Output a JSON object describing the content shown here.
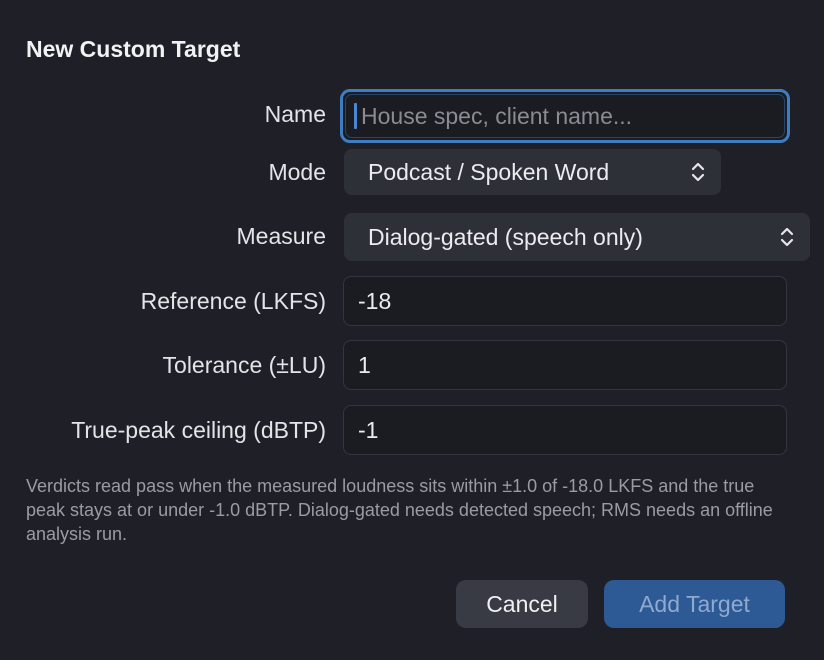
{
  "dialog": {
    "title": "New Custom Target",
    "name": {
      "label": "Name",
      "value": "",
      "placeholder": "House spec, client name..."
    },
    "mode": {
      "label": "Mode",
      "selected": "Podcast / Spoken Word"
    },
    "measure": {
      "label": "Measure",
      "selected": "Dialog-gated (speech only)"
    },
    "reference": {
      "label": "Reference (LKFS)",
      "value": "-18"
    },
    "tolerance": {
      "label": "Tolerance (±LU)",
      "value": "1"
    },
    "true_peak": {
      "label": "True-peak ceiling (dBTP)",
      "value": "-1"
    },
    "help_text": "Verdicts read pass when the measured loudness sits within ±1.0 of -18.0 LKFS and the true peak stays at or under -1.0 dBTP. Dialog-gated needs detected speech; RMS needs an offline analysis run.",
    "cancel_label": "Cancel",
    "add_label": "Add Target"
  },
  "colors": {
    "background": "#1f2027",
    "focus_ring": "#3f7dc2",
    "primary_button": "#2d5a94"
  }
}
